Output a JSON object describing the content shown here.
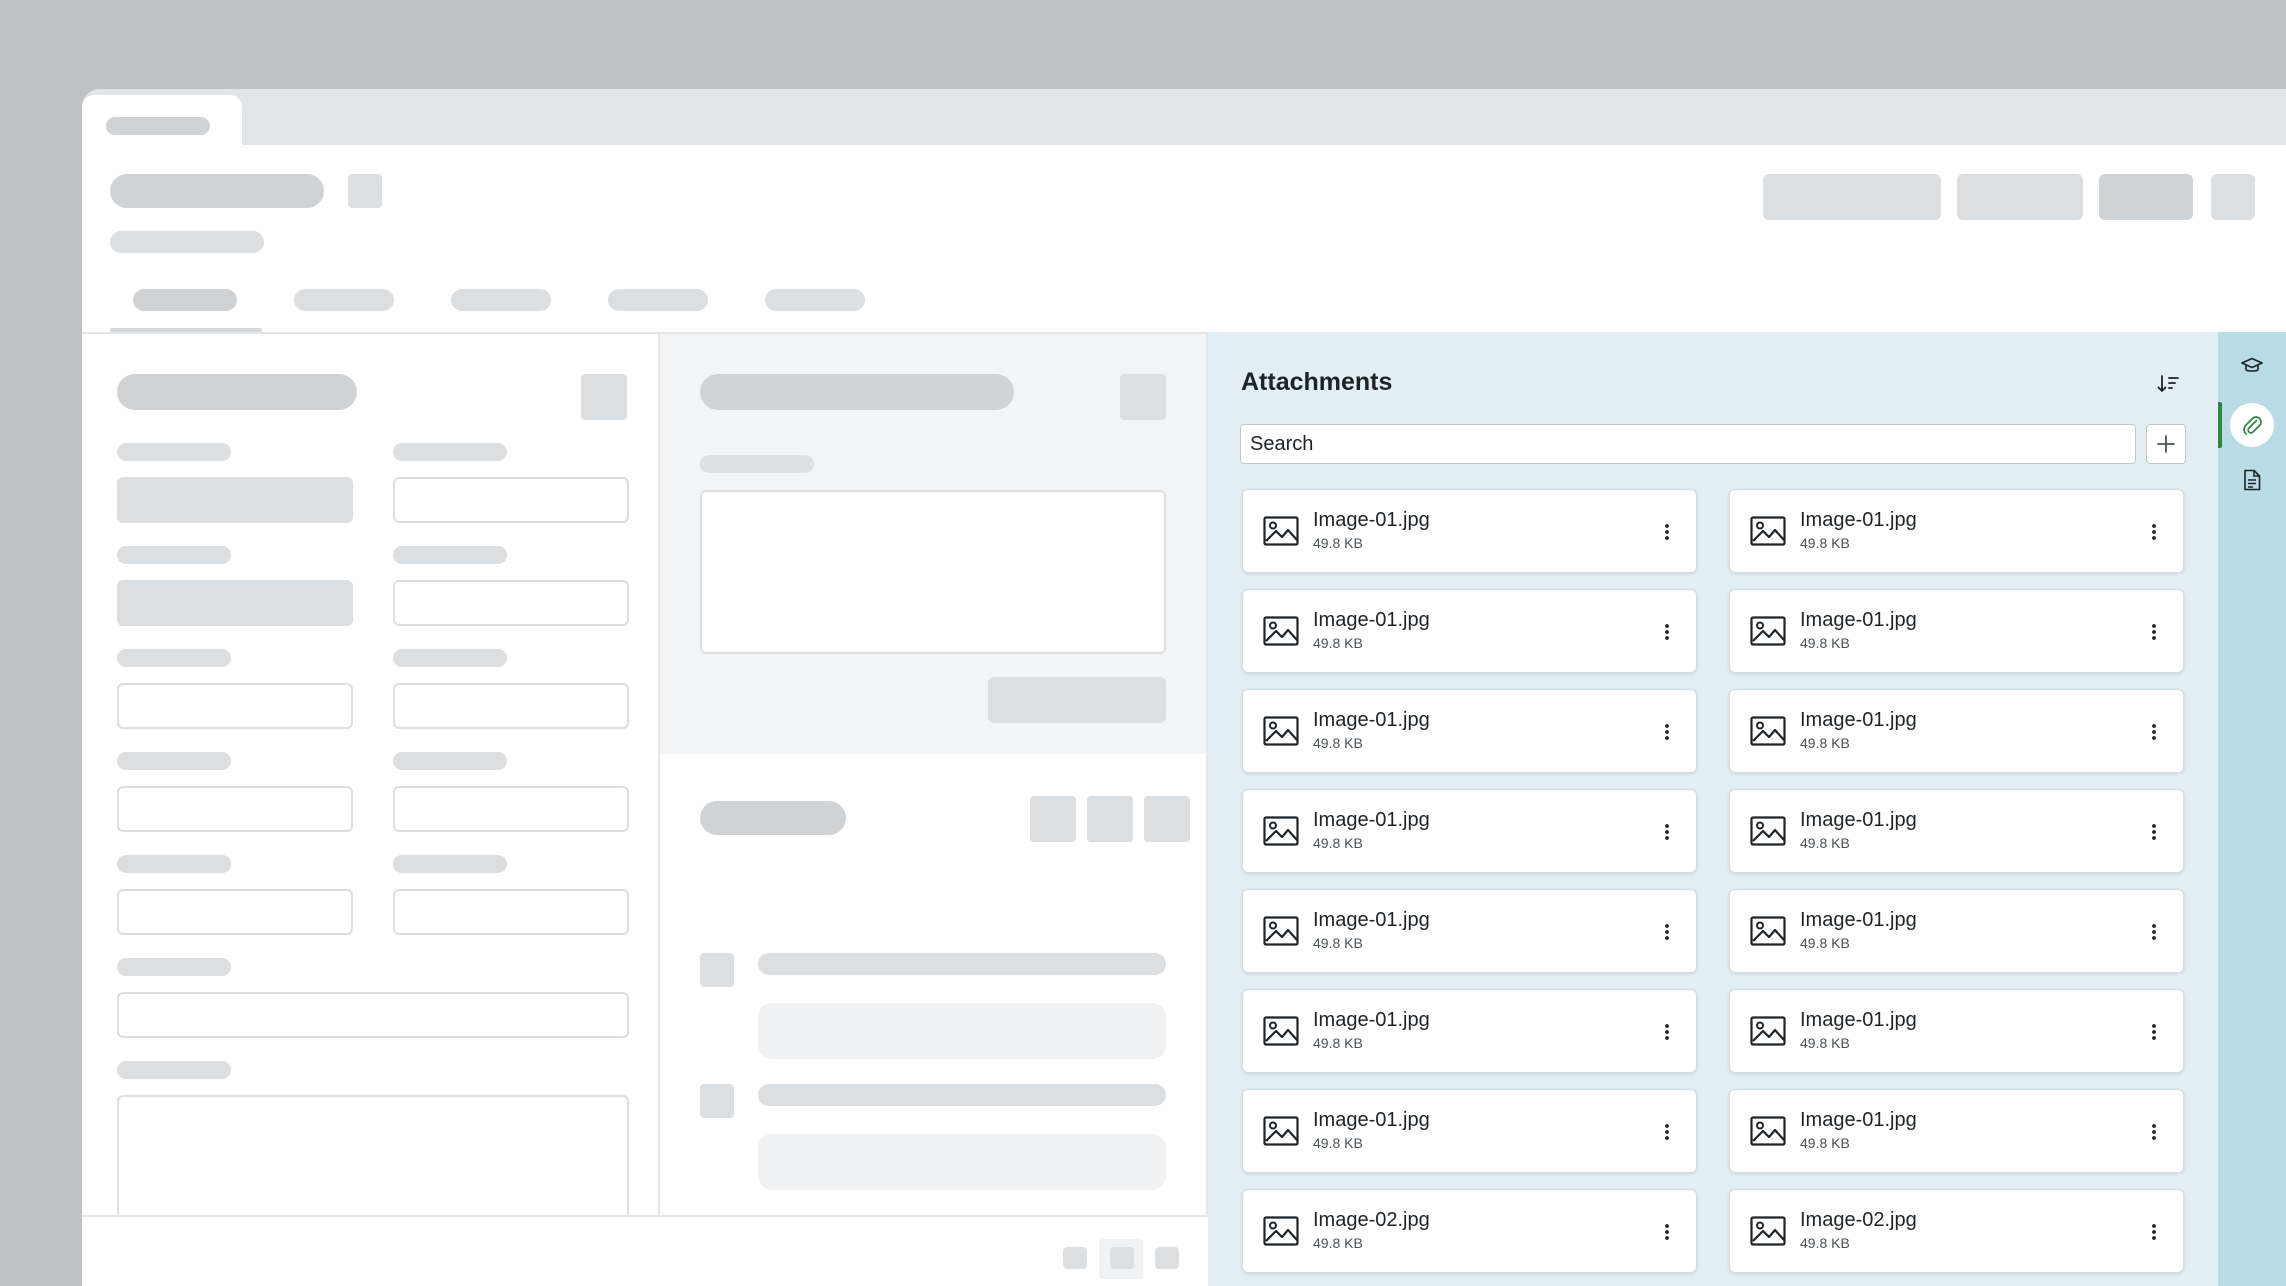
{
  "attachments": {
    "title": "Attachments",
    "search_placeholder": "Search",
    "sort_icon": "sort-icon",
    "add_icon": "plus-icon",
    "items": [
      {
        "name": "Image-01.jpg",
        "size": "49.8 KB"
      },
      {
        "name": "Image-01.jpg",
        "size": "49.8 KB"
      },
      {
        "name": "Image-01.jpg",
        "size": "49.8 KB"
      },
      {
        "name": "Image-01.jpg",
        "size": "49.8 KB"
      },
      {
        "name": "Image-01.jpg",
        "size": "49.8 KB"
      },
      {
        "name": "Image-01.jpg",
        "size": "49.8 KB"
      },
      {
        "name": "Image-01.jpg",
        "size": "49.8 KB"
      },
      {
        "name": "Image-01.jpg",
        "size": "49.8 KB"
      },
      {
        "name": "Image-01.jpg",
        "size": "49.8 KB"
      },
      {
        "name": "Image-01.jpg",
        "size": "49.8 KB"
      },
      {
        "name": "Image-01.jpg",
        "size": "49.8 KB"
      },
      {
        "name": "Image-01.jpg",
        "size": "49.8 KB"
      },
      {
        "name": "Image-01.jpg",
        "size": "49.8 KB"
      },
      {
        "name": "Image-01.jpg",
        "size": "49.8 KB"
      },
      {
        "name": "Image-02.jpg",
        "size": "49.8 KB"
      },
      {
        "name": "Image-02.jpg",
        "size": "49.8 KB"
      }
    ]
  },
  "rail": {
    "items": [
      {
        "icon": "graduation-cap-icon",
        "active": false
      },
      {
        "icon": "paperclip-icon",
        "active": true
      },
      {
        "icon": "document-icon",
        "active": false
      }
    ]
  },
  "colors": {
    "panel_bg": "#e2eff5",
    "rail_bg": "#b9dbe6",
    "active_indicator": "#2e8540",
    "placeholder": "#dcdfe2"
  }
}
